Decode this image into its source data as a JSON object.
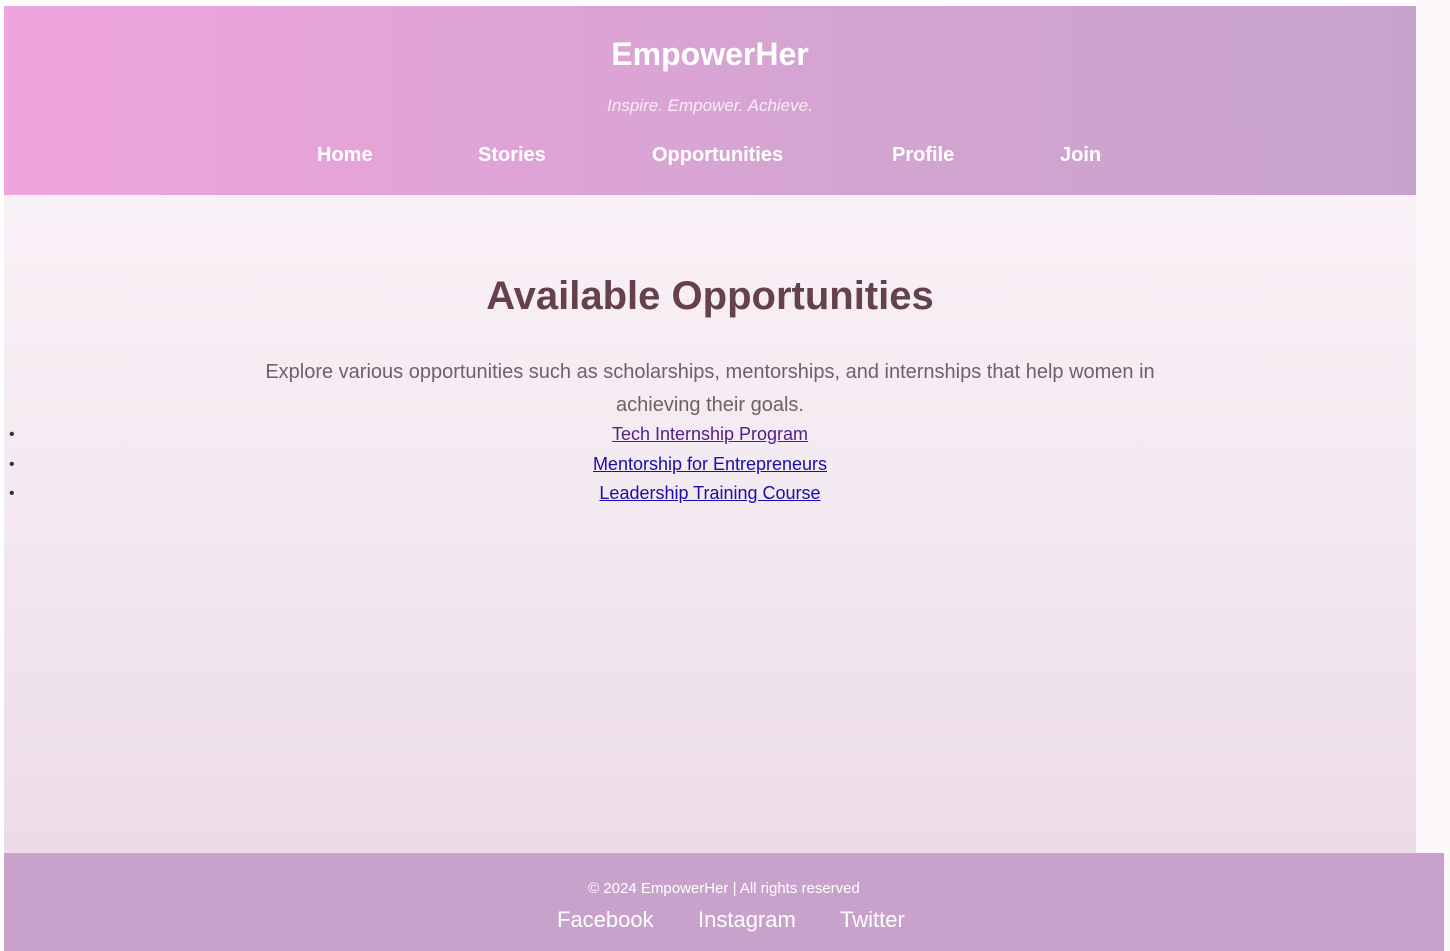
{
  "header": {
    "title": "EmpowerHer",
    "tagline": "Inspire. Empower. Achieve.",
    "nav": [
      {
        "label": "Home"
      },
      {
        "label": "Stories"
      },
      {
        "label": "Opportunities"
      },
      {
        "label": "Profile"
      },
      {
        "label": "Join"
      }
    ]
  },
  "main": {
    "title": "Available Opportunities",
    "intro": "Explore various opportunities such as scholarships, mentorships, and internships that help women in achieving their goals.",
    "opportunities": [
      {
        "label": "Tech Internship Program"
      },
      {
        "label": "Mentorship for Entrepreneurs"
      },
      {
        "label": "Leadership Training Course"
      }
    ]
  },
  "footer": {
    "copyright": "© 2024 EmpowerHer | All rights reserved",
    "social": [
      {
        "label": "Facebook"
      },
      {
        "label": "Instagram"
      },
      {
        "label": "Twitter"
      }
    ]
  },
  "colors": {
    "header_gradient_start": "#f0a4de",
    "header_gradient_end": "#c7a3cb",
    "footer_bg": "#c8a2cb",
    "heading": "#65404f",
    "link": "#1a0dab",
    "link_visited": "#52208a"
  }
}
